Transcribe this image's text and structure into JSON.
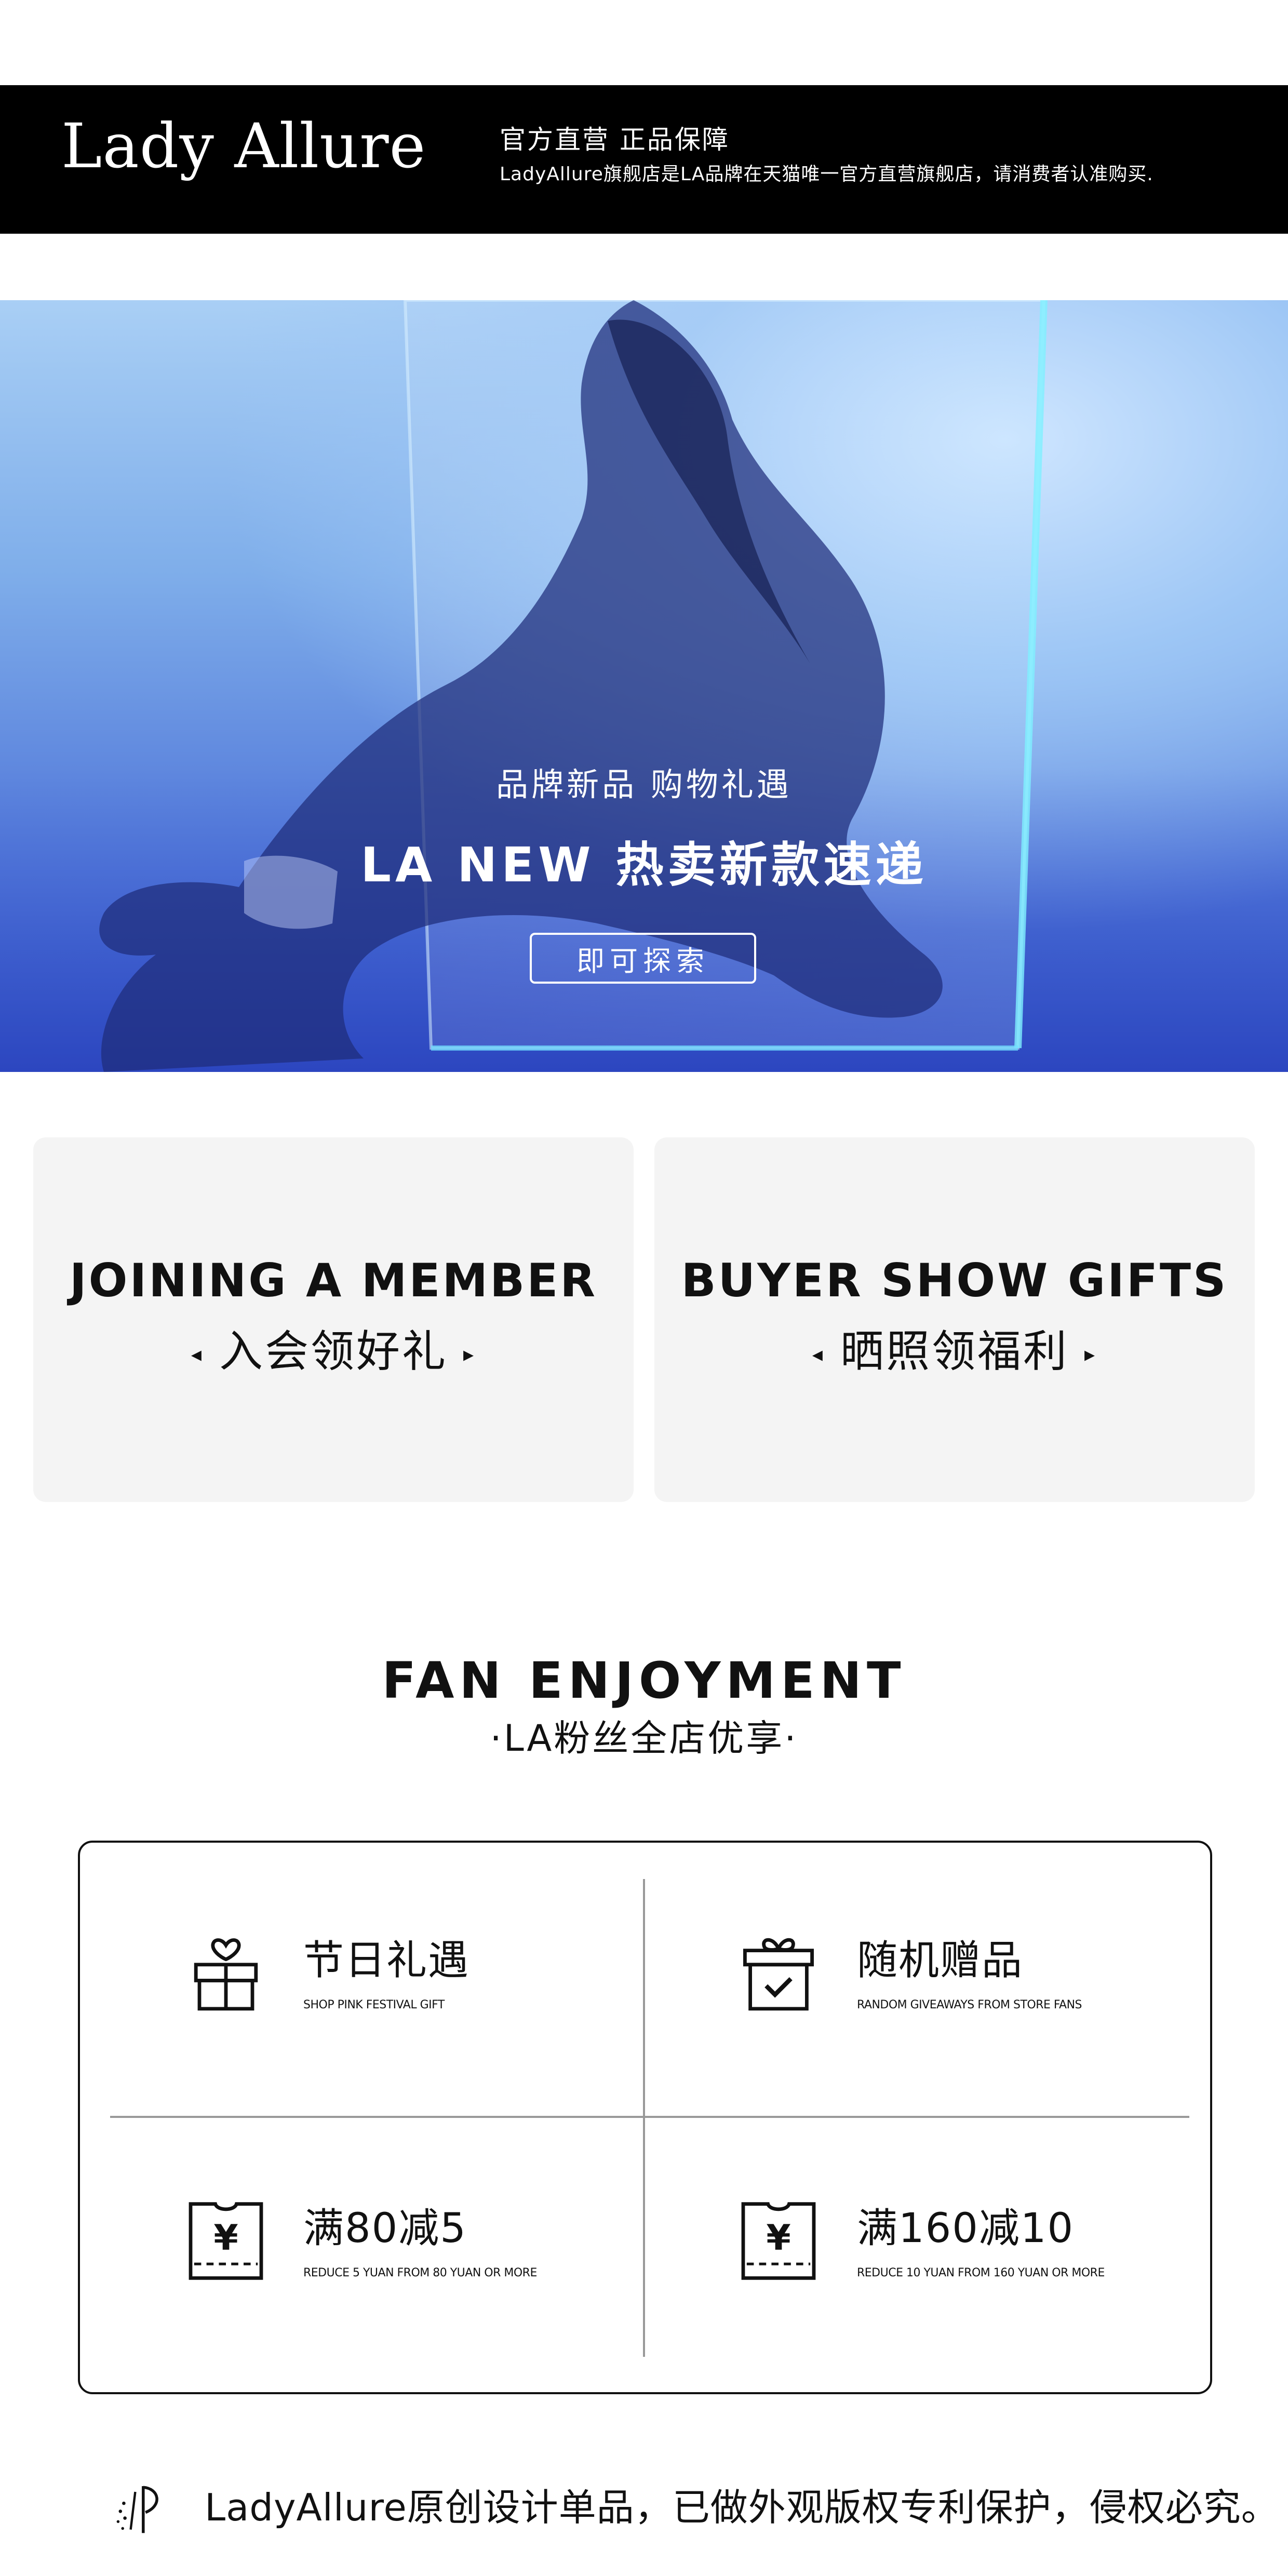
{
  "header": {
    "logo": "Lady Allure",
    "title": "官方直营 正品保障",
    "subtitle": "LadyAllure旗舰店是LA品牌在天猫唯一官方直营旗舰店，请消费者认准购买."
  },
  "hero": {
    "line1": "品牌新品 购物礼遇",
    "line2": "LA NEW 热卖新款速递",
    "button": "即可探索"
  },
  "cards": [
    {
      "en": "JOINING A MEMBER",
      "cn": "入会领好礼"
    },
    {
      "en": "BUYER SHOW GIFTS",
      "cn": "晒照领福利"
    }
  ],
  "fan": {
    "title": "FAN  ENJOYMENT",
    "subtitle": "·LA粉丝全店优享·",
    "cells": [
      {
        "title": "节日礼遇",
        "sub": "SHOP PINK FESTIVAL GIFT",
        "icon": "gift-box-heart-icon"
      },
      {
        "title": "随机赠品",
        "sub": "RANDOM GIVEAWAYS FROM STORE FANS",
        "icon": "gift-check-icon"
      },
      {
        "title": "满80减5",
        "sub": "REDUCE 5 YUAN FROM 80 YUAN OR MORE",
        "icon": "yen-coupon-icon"
      },
      {
        "title": "满160减10",
        "sub": "REDUCE 10 YUAN FROM 160 YUAN OR MORE",
        "icon": "yen-coupon-icon"
      }
    ]
  },
  "footer": {
    "text": "LadyAllure原创设计单品，已做外观版权专利保护，侵权必究。",
    "icon": "brand-mark-icon"
  },
  "colors": {
    "header_bg": "#000000",
    "card_bg": "#f4f4f4",
    "hero_blue": "#4e73d8"
  }
}
